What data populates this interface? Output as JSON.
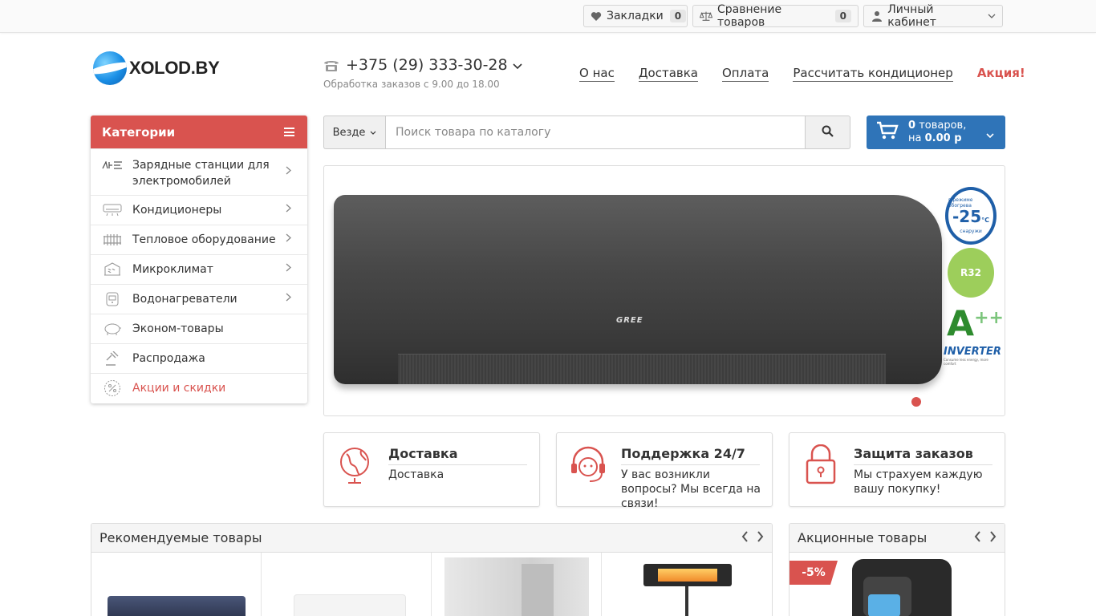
{
  "topbar": {
    "bookmarks": {
      "label": "Закладки",
      "count": "0",
      "icon": "heart-icon"
    },
    "compare": {
      "label": "Сравнение товаров",
      "count": "0",
      "icon": "balance-scale-icon"
    },
    "account": {
      "label": "Личный кабинет",
      "icon": "user-icon"
    }
  },
  "header": {
    "logo_text": "XOLOD.BY",
    "phone": "+375 (29) 333-30-28",
    "hours": "Обработка заказов с 9.00 до 18.00",
    "nav": [
      {
        "label": "О нас"
      },
      {
        "label": "Доставка"
      },
      {
        "label": "Оплата"
      },
      {
        "label": "Рассчитать кондиционер"
      },
      {
        "label": "Акция!",
        "highlight": true
      }
    ]
  },
  "categories": {
    "title": "Категории",
    "items": [
      {
        "label": "Зарядные станции для электромобилей",
        "icon": "ev-charger-icon",
        "has_children": true
      },
      {
        "label": "Кондиционеры",
        "icon": "air-conditioner-icon",
        "has_children": true
      },
      {
        "label": "Тепловое оборудование",
        "icon": "radiator-icon",
        "has_children": true
      },
      {
        "label": "Микроклимат",
        "icon": "humidifier-icon",
        "has_children": true
      },
      {
        "label": "Водонагреватели",
        "icon": "water-heater-icon",
        "has_children": true
      },
      {
        "label": "Эконом-товары",
        "icon": "piggy-bank-icon",
        "has_children": false
      },
      {
        "label": "Распродажа",
        "icon": "gavel-icon",
        "has_children": false
      },
      {
        "label": "Акции и скидки",
        "icon": "percent-icon",
        "has_children": false,
        "highlight": true
      }
    ]
  },
  "search": {
    "scope": "Везде",
    "placeholder": "Поиск товара по каталогу"
  },
  "cart": {
    "count_text": "0",
    "count_suffix": "товаров,",
    "total_prefix": "на",
    "total": "0.00 р"
  },
  "banner": {
    "brand": "GREE",
    "badge_temp_top": "в режиме обогрева",
    "badge_temp_value": "-25",
    "badge_temp_unit": "°C",
    "badge_temp_bottom": "снаружи",
    "badge_refrigerant": "R32",
    "badge_energy": "A",
    "badge_energy_sup": "++",
    "badge_inverter": "INVERTER",
    "badge_inverter_sub": "Consume less energy, more comfort"
  },
  "features": [
    {
      "title": "Доставка",
      "desc": "Доставка",
      "icon": "globe-icon"
    },
    {
      "title": "Поддержка 24/7",
      "desc": "У вас возникли вопросы? Мы всегда на связи!",
      "icon": "headset-icon"
    },
    {
      "title": "Защита заказов",
      "desc": "Мы страхуем каждую вашу покупку!",
      "icon": "lock-icon"
    }
  ],
  "sections": {
    "recommended": {
      "title": "Рекомендуемые товары"
    },
    "promo": {
      "title": "Акционные товары",
      "sale_badge": "-5%"
    }
  },
  "colors": {
    "accent_red": "#d9534f",
    "cart_blue": "#2f74b8"
  }
}
